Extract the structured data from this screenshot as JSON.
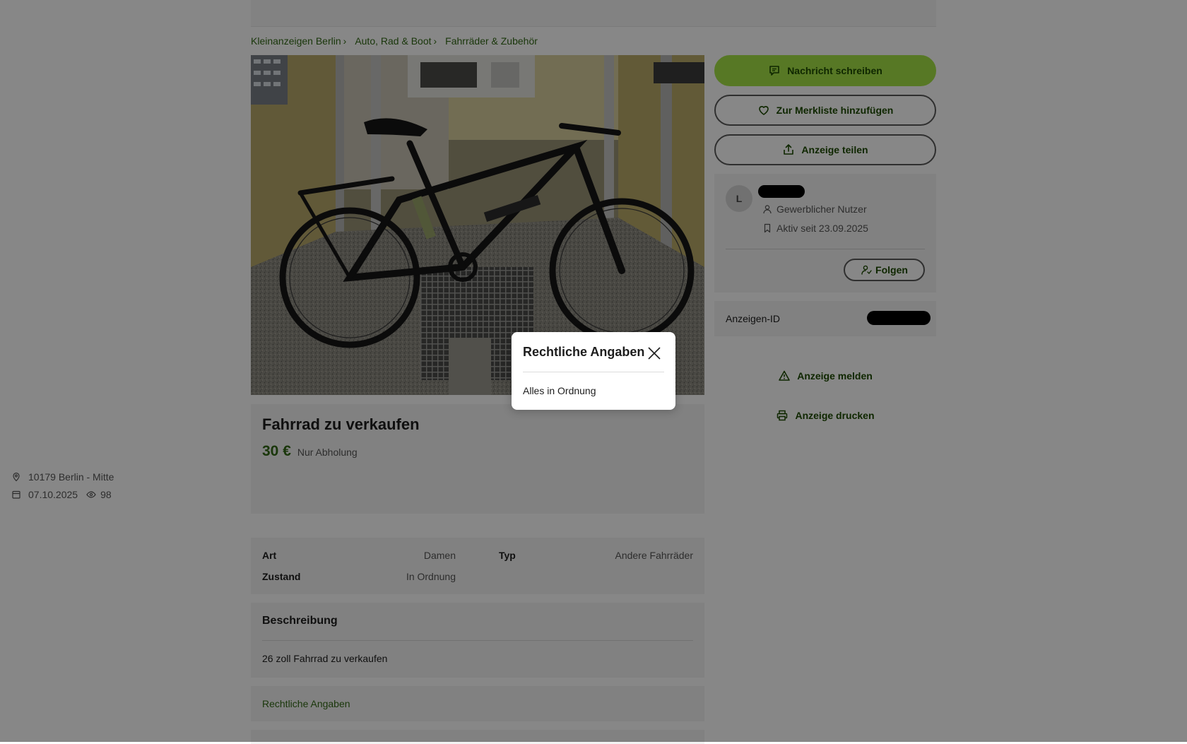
{
  "breadcrumb": [
    {
      "label": "Kleinanzeigen Berlin"
    },
    {
      "label": "Auto, Rad & Boot"
    },
    {
      "label": "Fahrräder & Zubehör"
    }
  ],
  "breadcrumb_separator": "›",
  "listing": {
    "title": "Fahrrad zu verkaufen",
    "price": "30 €",
    "shipping": "Nur Abholung",
    "location": "10179 Berlin - Mitte",
    "date": "07.10.2025",
    "views": "98"
  },
  "attributes": [
    {
      "key": "Art",
      "value": "Damen"
    },
    {
      "key": "Typ",
      "value": "Andere Fahrräder"
    },
    {
      "key": "Zustand",
      "value": "In Ordnung"
    }
  ],
  "description": {
    "heading": "Beschreibung",
    "text": "26 zoll Fahrrad zu verkaufen"
  },
  "legal": {
    "link_label": "Rechtliche Angaben"
  },
  "actions": {
    "message_label": "Nachricht schreiben",
    "watchlist_label": "Zur Merkliste hinzufügen",
    "share_label": "Anzeige teilen",
    "report_label": "Anzeige melden",
    "print_label": "Anzeige drucken"
  },
  "seller": {
    "avatar_initial": "L",
    "type": "Gewerblicher Nutzer",
    "active_since": "Aktiv seit 23.09.2025",
    "follow_label": "Folgen"
  },
  "ad_id": {
    "label": "Anzeigen-ID"
  },
  "modal": {
    "title": "Rechtliche Angaben",
    "body": "Alles in Ordnung"
  },
  "colors": {
    "brand_green": "#a5e347",
    "link_green": "#326916",
    "overlay": "rgba(0,0,0,0.47)"
  },
  "icons": {
    "chat": "chat-icon",
    "heart": "heart-icon",
    "share": "share-icon",
    "user": "user-icon",
    "bookmark": "bookmark-icon",
    "follow": "follow-icon",
    "warning": "warning-icon",
    "print": "printer-icon",
    "pin": "location-pin-icon",
    "calendar": "calendar-icon",
    "eye": "eye-icon",
    "close": "close-icon"
  }
}
